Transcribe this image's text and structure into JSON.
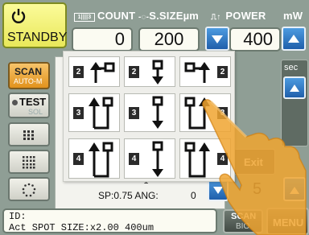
{
  "standby": {
    "label": "STANDBY",
    "icon": "power-icon"
  },
  "header": {
    "count_icon_text": "1||||3",
    "count_label": "COUNT",
    "spot_size_label": "S.SIZEµm",
    "power_icon_text": "⎍↑",
    "power_label": "POWER",
    "power_unit": "mW",
    "count_value": "0",
    "spot_size_value": "200",
    "power_value": "400"
  },
  "side_buttons": {
    "scan_label": "SCAN",
    "scan_sub_label": "AUTO-M",
    "test_label": "TEST",
    "test_sub_label": "SOL"
  },
  "right_panel": {
    "sec_label": "sec",
    "exit_label": "Exit",
    "partial_value": "5"
  },
  "background_panel": {
    "sp_ang_text": "SP:0.75 ANG:",
    "ang_value": "0"
  },
  "status": {
    "line1": "ID:",
    "line2": "Act SPOT SIZE:x2.00  400um"
  },
  "bottom_buttons": {
    "scan_bio_line1": "SCAN",
    "scan_bio_line2": "BIO",
    "menu_label": "MENU"
  },
  "pattern_grid": {
    "rows": [
      {
        "number": "2",
        "cells": [
          {
            "number": "2",
            "pattern": "arrow-up-square"
          },
          {
            "number": "2",
            "pattern": "arrow-down-square"
          },
          {
            "number": "2",
            "pattern": "square-arrow-up"
          }
        ]
      },
      {
        "number": "3",
        "cells": [
          {
            "number": "3",
            "pattern": "arrow-up-square"
          },
          {
            "number": "3",
            "pattern": "arrow-down-square"
          },
          {
            "number": "3",
            "pattern": "square-arrow-up"
          }
        ]
      },
      {
        "number": "4",
        "cells": [
          {
            "number": "4",
            "pattern": "arrow-up-square"
          },
          {
            "number": "4",
            "pattern": "arrow-down-square"
          },
          {
            "number": "4",
            "pattern": "square-arrow-up"
          }
        ]
      }
    ]
  },
  "colors": {
    "standby_bg": "#f3f27c",
    "scan_button": "#eea83a",
    "blue_button": "#2a72c3",
    "hand": "#f0a530"
  }
}
